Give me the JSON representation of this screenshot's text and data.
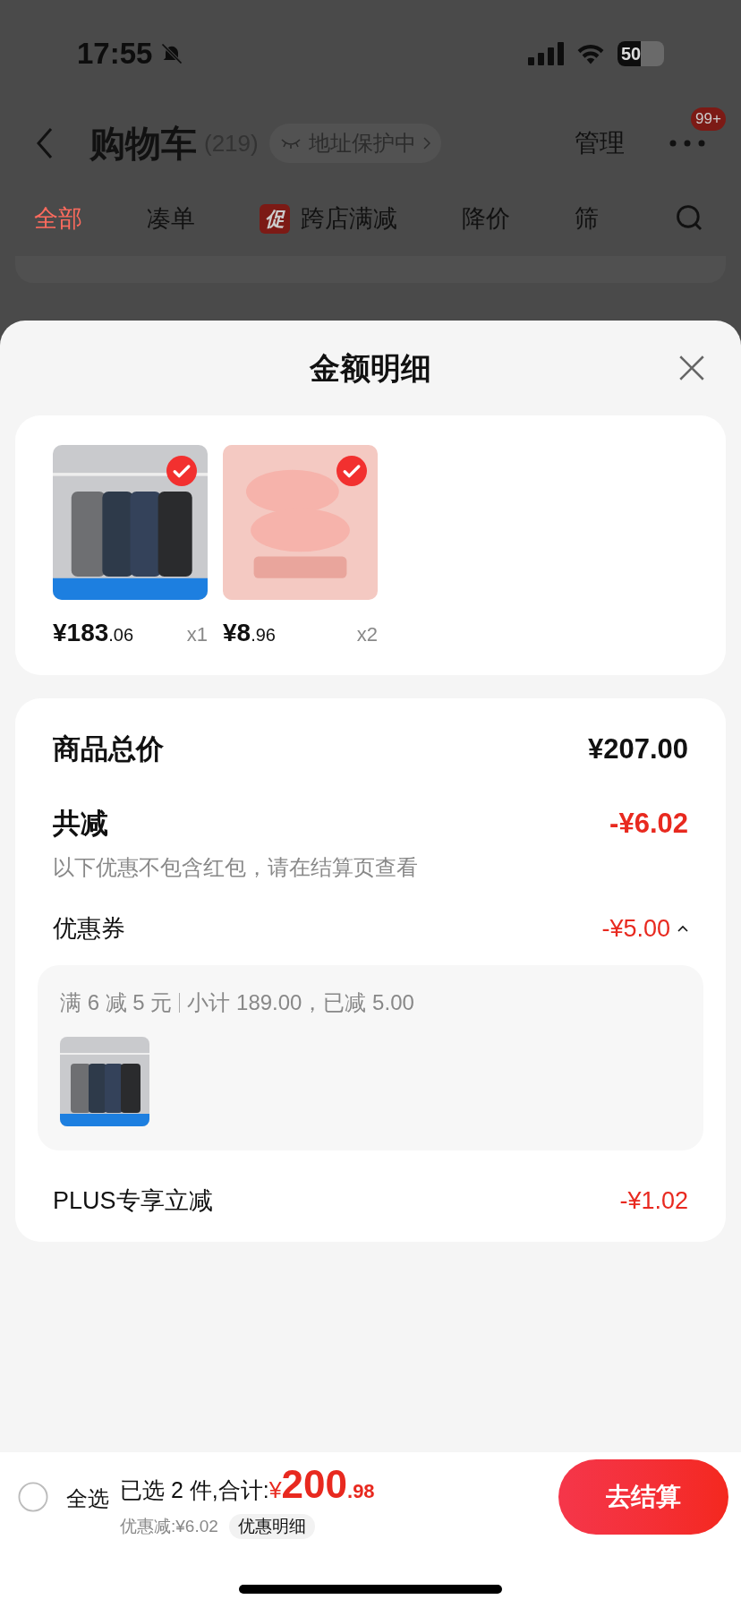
{
  "status_bar": {
    "time": "17:55",
    "battery": "50"
  },
  "header": {
    "title": "购物车",
    "count": "(219)",
    "address": "地址保护中",
    "manage": "管理",
    "badge": "99+"
  },
  "tabs": [
    {
      "label": "全部",
      "selected": true
    },
    {
      "label": "凑单",
      "selected": false
    },
    {
      "label": "跨店满减",
      "selected": false,
      "tag": "促"
    },
    {
      "label": "降价",
      "selected": false
    },
    {
      "label": "筛",
      "selected": false
    }
  ],
  "sheet": {
    "title": "金额明细"
  },
  "products": [
    {
      "kind": "jacket",
      "price": "¥183",
      "price_decimal": ".06",
      "quantity": "x1",
      "checked": true
    },
    {
      "kind": "slippers",
      "price": "¥8",
      "price_decimal": ".96",
      "quantity": "x2",
      "checked": true
    }
  ],
  "summary": {
    "total_label": "商品总价",
    "total": "¥207.00",
    "discount_label": "共减",
    "discount": "-¥6.02",
    "note": "以下优惠不包含红包，请在结算页查看",
    "coupon": {
      "label": "优惠券",
      "value": "-¥5.00",
      "expanded": true,
      "rule": "满 6 减 5 元",
      "detail": "小计 189.00，已减 5.00"
    },
    "plus_label": "PLUS专享立减",
    "plus_value": "-¥1.02"
  },
  "bottom_bar": {
    "select_all": {
      "label": "全选",
      "checked": false
    },
    "selected_text": "已选 2 件,合计:",
    "currency": "¥",
    "amount": "200",
    "amount_decimal": ".98",
    "saving": "优惠减:¥6.02",
    "detail_button": "优惠明细",
    "checkout": "去结算"
  }
}
